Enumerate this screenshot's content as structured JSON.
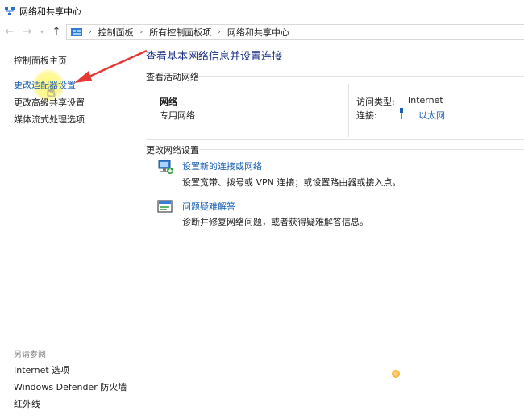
{
  "window": {
    "title": "网络和共享中心"
  },
  "address": {
    "crumbs": [
      "控制面板",
      "所有控制面板项",
      "网络和共享中心"
    ]
  },
  "left_pane": {
    "links": [
      "控制面板主页",
      "更改适配器设置",
      "更改高级共享设置",
      "媒体流式处理选项"
    ],
    "see_also": "另请参阅",
    "see_also_links": [
      "Internet 选项",
      "Windows Defender 防火墙",
      "红外线"
    ]
  },
  "main": {
    "title": "查看基本网络信息并设置连接",
    "active_header": "查看活动网络",
    "network": {
      "name": "网络",
      "type": "专用网络",
      "access_label": "访问类型:",
      "access_value": "Internet",
      "conn_label": "连接:",
      "conn_value": "以太网"
    },
    "change_header": "更改网络设置",
    "tasks": [
      {
        "title": "设置新的连接或网络",
        "desc": "设置宽带、拨号或 VPN 连接；或设置路由器或接入点。"
      },
      {
        "title": "问题疑难解答",
        "desc": "诊断并修复网络问题，或者获得疑难解答信息。"
      }
    ]
  },
  "colors": {
    "link": "#1a5fb4",
    "title": "#1e3287",
    "arrow": "#e53935"
  }
}
